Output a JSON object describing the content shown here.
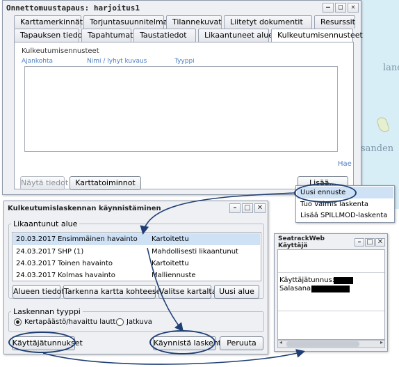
{
  "main_window": {
    "title": "Onnettomuustapaus: harjoitus1",
    "tabs_row1": [
      "Karttamerkinnät",
      "Torjuntasuunnitelmat",
      "Tilannekuvat",
      "Liitetyt dokumentit",
      "Resurssit"
    ],
    "tabs_row2": [
      "Tapauksen tiedot",
      "Tapahtumat",
      "Taustatiedot",
      "Likaantuneet alueet",
      "Kulkeutumisennusteet"
    ],
    "active_tab": "Kulkeutumisennusteet",
    "section_title": "Kulkeutumisennusteet",
    "columns": [
      "Ajankohta",
      "Nimi / lyhyt kuvaus",
      "Tyyppi"
    ],
    "hae_link": "Hae",
    "show_button": "Näytä tiedot",
    "map_button": "Karttatoiminnot",
    "more_button": "Lisää..."
  },
  "dropdown": {
    "items": [
      "Uusi ennuste",
      "Tuo valmis laskenta",
      "Lisää SPILLMOD-laskenta"
    ]
  },
  "launch_window": {
    "title": "Kulkeutumislaskennan käynnistäminen",
    "area_group": "Likaantunut alue",
    "rows": [
      {
        "date": "20.03.2017",
        "name": "Ensimmäinen havainto",
        "type": "Kartoitettu"
      },
      {
        "date": "24.03.2017",
        "name": "SHP (1)",
        "type": "Mahdollisesti likaantunut"
      },
      {
        "date": "24.03.2017",
        "name": "Toinen havainto",
        "type": "Kartoitettu"
      },
      {
        "date": "24.03.2017",
        "name": "Kolmas havainto",
        "type": "Malliennuste"
      }
    ],
    "area_buttons": [
      "Alueen tiedot",
      "Tarkenna kartta kohteeseen",
      "Valitse kartalta",
      "Uusi alue"
    ],
    "calc_group": "Laskennan tyyppi",
    "radio1": "Kertapäästö/havaittu lautta",
    "radio2": "Jatkuva",
    "credentials_button": "Käyttäjätunnukset",
    "start_button": "Käynnistä laskenta",
    "cancel_button": "Peruuta"
  },
  "seatrack_window": {
    "title": "SeatrackWeb Käyttäjä",
    "username_label": "Käyttäjätunnus:",
    "password_label": "Salasana:"
  },
  "map_labels": [
    "land",
    "sanden"
  ],
  "colors": {
    "accent_link": "#4a7fc4",
    "selection": "#cfe1f5",
    "annotation": "#1f3f73"
  }
}
